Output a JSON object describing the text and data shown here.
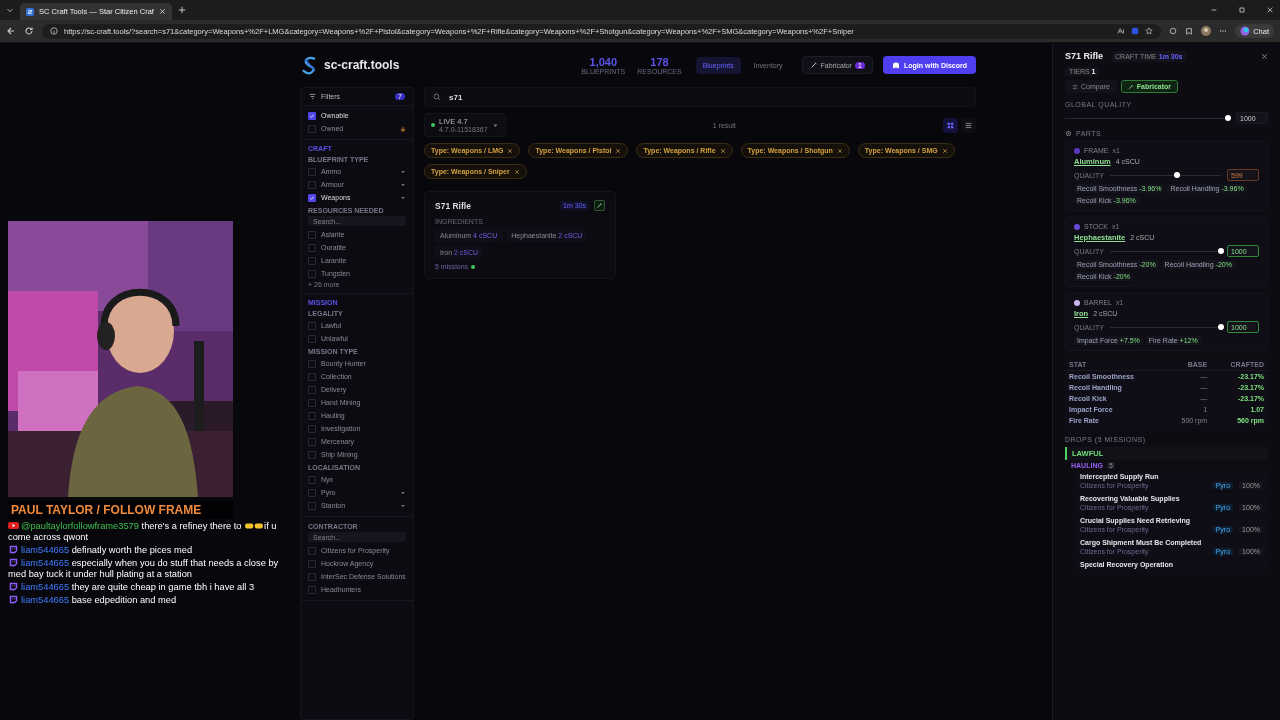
{
  "browser": {
    "tab_title": "SC Craft Tools — Star Citizen Craf",
    "url": "https://sc-craft.tools/?search=s71&category=Weapons+%2F+LMG&category=Weapons+%2F+Pistol&category=Weapons+%2F+Rifle&category=Weapons+%2F+Shotgun&category=Weapons+%2F+SMG&category=Weapons+%2F+Sniper",
    "chat_button": "Chat"
  },
  "header": {
    "logo": "sc-craft.tools",
    "stats": [
      {
        "value": "1,040",
        "label": "BLUEPRINTS"
      },
      {
        "value": "178",
        "label": "RESOURCES"
      }
    ],
    "nav": [
      {
        "label": "Blueprints",
        "selected": true
      },
      {
        "label": "Inventory",
        "selected": false
      }
    ],
    "fabricator": {
      "label": "Fabricator",
      "badge": "1"
    },
    "login": "Login with Discord"
  },
  "sidebar": {
    "title": "Filters",
    "count": "7",
    "toggles": [
      {
        "label": "Ownable",
        "checked": true,
        "locked": false
      },
      {
        "label": "Owned",
        "checked": false,
        "locked": true
      }
    ],
    "groups": [
      {
        "label": "CRAFT",
        "sections": [
          {
            "title": "BLUEPRINT TYPE",
            "options": [
              {
                "label": "Ammo",
                "checked": false,
                "expandable": true
              },
              {
                "label": "Armour",
                "checked": false,
                "expandable": true
              },
              {
                "label": "Weapons",
                "checked": true,
                "expandable": true
              }
            ]
          },
          {
            "title": "RESOURCES NEEDED",
            "search_placeholder": "Search...",
            "options": [
              {
                "label": "Aslarite",
                "checked": false,
                "expandable": false
              },
              {
                "label": "Ouratite",
                "checked": false,
                "expandable": false
              },
              {
                "label": "Laranite",
                "checked": false,
                "expandable": false
              },
              {
                "label": "Tungsten",
                "checked": false,
                "expandable": false
              }
            ],
            "more": "+ 26 more"
          }
        ]
      },
      {
        "label": "MISSION",
        "sections": [
          {
            "title": "LEGALITY",
            "options": [
              {
                "label": "Lawful",
                "checked": false,
                "expandable": false
              },
              {
                "label": "Unlawful",
                "checked": false,
                "expandable": false
              }
            ]
          },
          {
            "title": "MISSION TYPE",
            "options": [
              {
                "label": "Bounty Hunter",
                "checked": false,
                "expandable": false
              },
              {
                "label": "Collection",
                "checked": false,
                "expandable": false
              },
              {
                "label": "Delivery",
                "checked": false,
                "expandable": false
              },
              {
                "label": "Hand Mining",
                "checked": false,
                "expandable": false
              },
              {
                "label": "Hauling",
                "checked": false,
                "expandable": false
              },
              {
                "label": "Investigation",
                "checked": false,
                "expandable": false
              },
              {
                "label": "Mercenary",
                "checked": false,
                "expandable": false
              },
              {
                "label": "Ship Mining",
                "checked": false,
                "expandable": false
              }
            ]
          },
          {
            "title": "LOCALISATION",
            "options": [
              {
                "label": "Nyx",
                "checked": false,
                "expandable": false
              },
              {
                "label": "Pyro",
                "checked": false,
                "expandable": true
              },
              {
                "label": "Stanton",
                "checked": false,
                "expandable": true
              }
            ]
          }
        ]
      },
      {
        "sections": [
          {
            "title": "CONTRACTOR",
            "search_placeholder": "Search...",
            "options": [
              {
                "label": "Citizens for Prosperity",
                "checked": false,
                "expandable": false
              },
              {
                "label": "Hockrow Agency",
                "checked": false,
                "expandable": false
              },
              {
                "label": "InterSec Defense Solutions",
                "checked": false,
                "expandable": false
              },
              {
                "label": "Headhunters",
                "checked": false,
                "expandable": false
              }
            ]
          }
        ]
      }
    ]
  },
  "content": {
    "search": {
      "value": "s71"
    },
    "version": {
      "label": "LIVE 4.7",
      "build": "4.7.0-11518367"
    },
    "result_count": "1 result",
    "view": [
      {
        "kind": "grid",
        "selected": true
      },
      {
        "kind": "list",
        "selected": false
      }
    ],
    "chips": [
      "Type: Weapons / LMG",
      "Type: Weapons / Pistol",
      "Type: Weapons / Rifle",
      "Type: Weapons / Shotgun",
      "Type: Weapons / SMG",
      "Type: Weapons / Sniper"
    ],
    "cards": [
      {
        "title": "S71 Rifle",
        "time": "1m 30s",
        "ingredients_label": "INGREDIENTS",
        "ingredients": [
          {
            "name": "Aluminum",
            "qty": "4 cSCU"
          },
          {
            "name": "Hephaestanite",
            "qty": "2 cSCU"
          },
          {
            "name": "Iron",
            "qty": "2 cSCU"
          }
        ],
        "missions": "5 missions"
      }
    ]
  },
  "panel": {
    "title": "S71 Rifle",
    "craft_time_label": "CRAFT TIME",
    "craft_time": "1m 30s",
    "tiers_label": "TIERS",
    "tiers": "1",
    "buttons": [
      {
        "kind": "compare",
        "label": "Compare",
        "selected": false
      },
      {
        "kind": "fabricator",
        "label": "Fabricator",
        "selected": true
      }
    ],
    "global_quality": {
      "label": "GLOBAL QUALITY",
      "level": 1,
      "value": "1000"
    },
    "parts_label": "PARTS",
    "parts": [
      {
        "name": "FRAME",
        "count": "x1",
        "color": "#5a3bc4",
        "material": "Aluminum",
        "qty": "4 cSCU",
        "quality_label": "QUALITY",
        "level": 0.6,
        "value": "599",
        "low": true,
        "effects": [
          {
            "name": "Recoil Smoothness",
            "value": "-3.96%"
          },
          {
            "name": "Recoil Handling",
            "value": "-3.96%"
          },
          {
            "name": "Recoil Kick",
            "value": "-3.96%"
          }
        ]
      },
      {
        "name": "STOCK",
        "count": "x1",
        "color": "#6a4ad8",
        "material": "Hephaestanite",
        "qty": "2 cSCU",
        "quality_label": "QUALITY",
        "level": 1,
        "value": "1000",
        "low": false,
        "effects": [
          {
            "name": "Recoil Smoothness",
            "value": "-20%"
          },
          {
            "name": "Recoil Handling",
            "value": "-20%"
          },
          {
            "name": "Recoil Kick",
            "value": "-20%"
          }
        ]
      },
      {
        "name": "BARREL",
        "count": "x1",
        "color": "#c9b8f5",
        "material": "Iron",
        "qty": "2 cSCU",
        "quality_label": "QUALITY",
        "level": 1,
        "value": "1000",
        "low": false,
        "effects": [
          {
            "name": "Impact Force",
            "value": "+7.5%"
          },
          {
            "name": "Fire Rate",
            "value": "+12%"
          }
        ]
      }
    ],
    "stats": {
      "columns": [
        "STAT",
        "BASE",
        "CRAFTED"
      ],
      "rows": [
        {
          "stat": "Recoil Smoothness",
          "base": "—",
          "crafted": "-23.17%"
        },
        {
          "stat": "Recoil Handling",
          "base": "—",
          "crafted": "-23.17%"
        },
        {
          "stat": "Recoil Kick",
          "base": "—",
          "crafted": "-23.17%"
        },
        {
          "stat": "Impact Force",
          "base": "1",
          "crafted": "1.07"
        },
        {
          "stat": "Fire Rate",
          "base": "500 rpm",
          "crafted": "560 rpm"
        }
      ]
    },
    "drops": {
      "title": "DROPS (5 MISSIONS)",
      "legality": "LAWFUL",
      "type": "HAULING",
      "type_count": "5",
      "missions": [
        {
          "name": "Intercepted Supply Run",
          "contractor": "Citizens for Prosperity",
          "location": "Pyro",
          "chance": "100%"
        },
        {
          "name": "Recovering Valuable Supplies",
          "contractor": "Citizens for Prosperity",
          "location": "Pyro",
          "chance": "100%"
        },
        {
          "name": "Crucial Supplies Need Retrieving",
          "contractor": "Citizens for Prosperity",
          "location": "Pyro",
          "chance": "100%"
        },
        {
          "name": "Cargo Shipment Must Be Completed",
          "contractor": "Citizens for Prosperity",
          "location": "Pyro",
          "chance": "100%"
        },
        {
          "name": "Special Recovery Operation"
        }
      ]
    }
  },
  "stream_overlay": {
    "name": "PAUL TAYLOR / FOLLOW FRAME",
    "chat": [
      {
        "kind": "youtube",
        "user": "@paultaylorfollowframe3579",
        "text": "there's a refiney there to",
        "text_after": "if u come across qwont"
      },
      {
        "kind": "twitch",
        "user": "liam544665",
        "text": "definatly worth the pices med"
      },
      {
        "kind": "twitch",
        "user": "liam544665",
        "text": "especially when you do stuff that needs a close by med bay tuck it under hull plating at a station"
      },
      {
        "kind": "twitch",
        "user": "liam544665",
        "text": "they are quite cheap in game tbh i have all 3"
      },
      {
        "kind": "twitch",
        "user": "liam544665",
        "text": "base edpedition and med"
      }
    ]
  }
}
